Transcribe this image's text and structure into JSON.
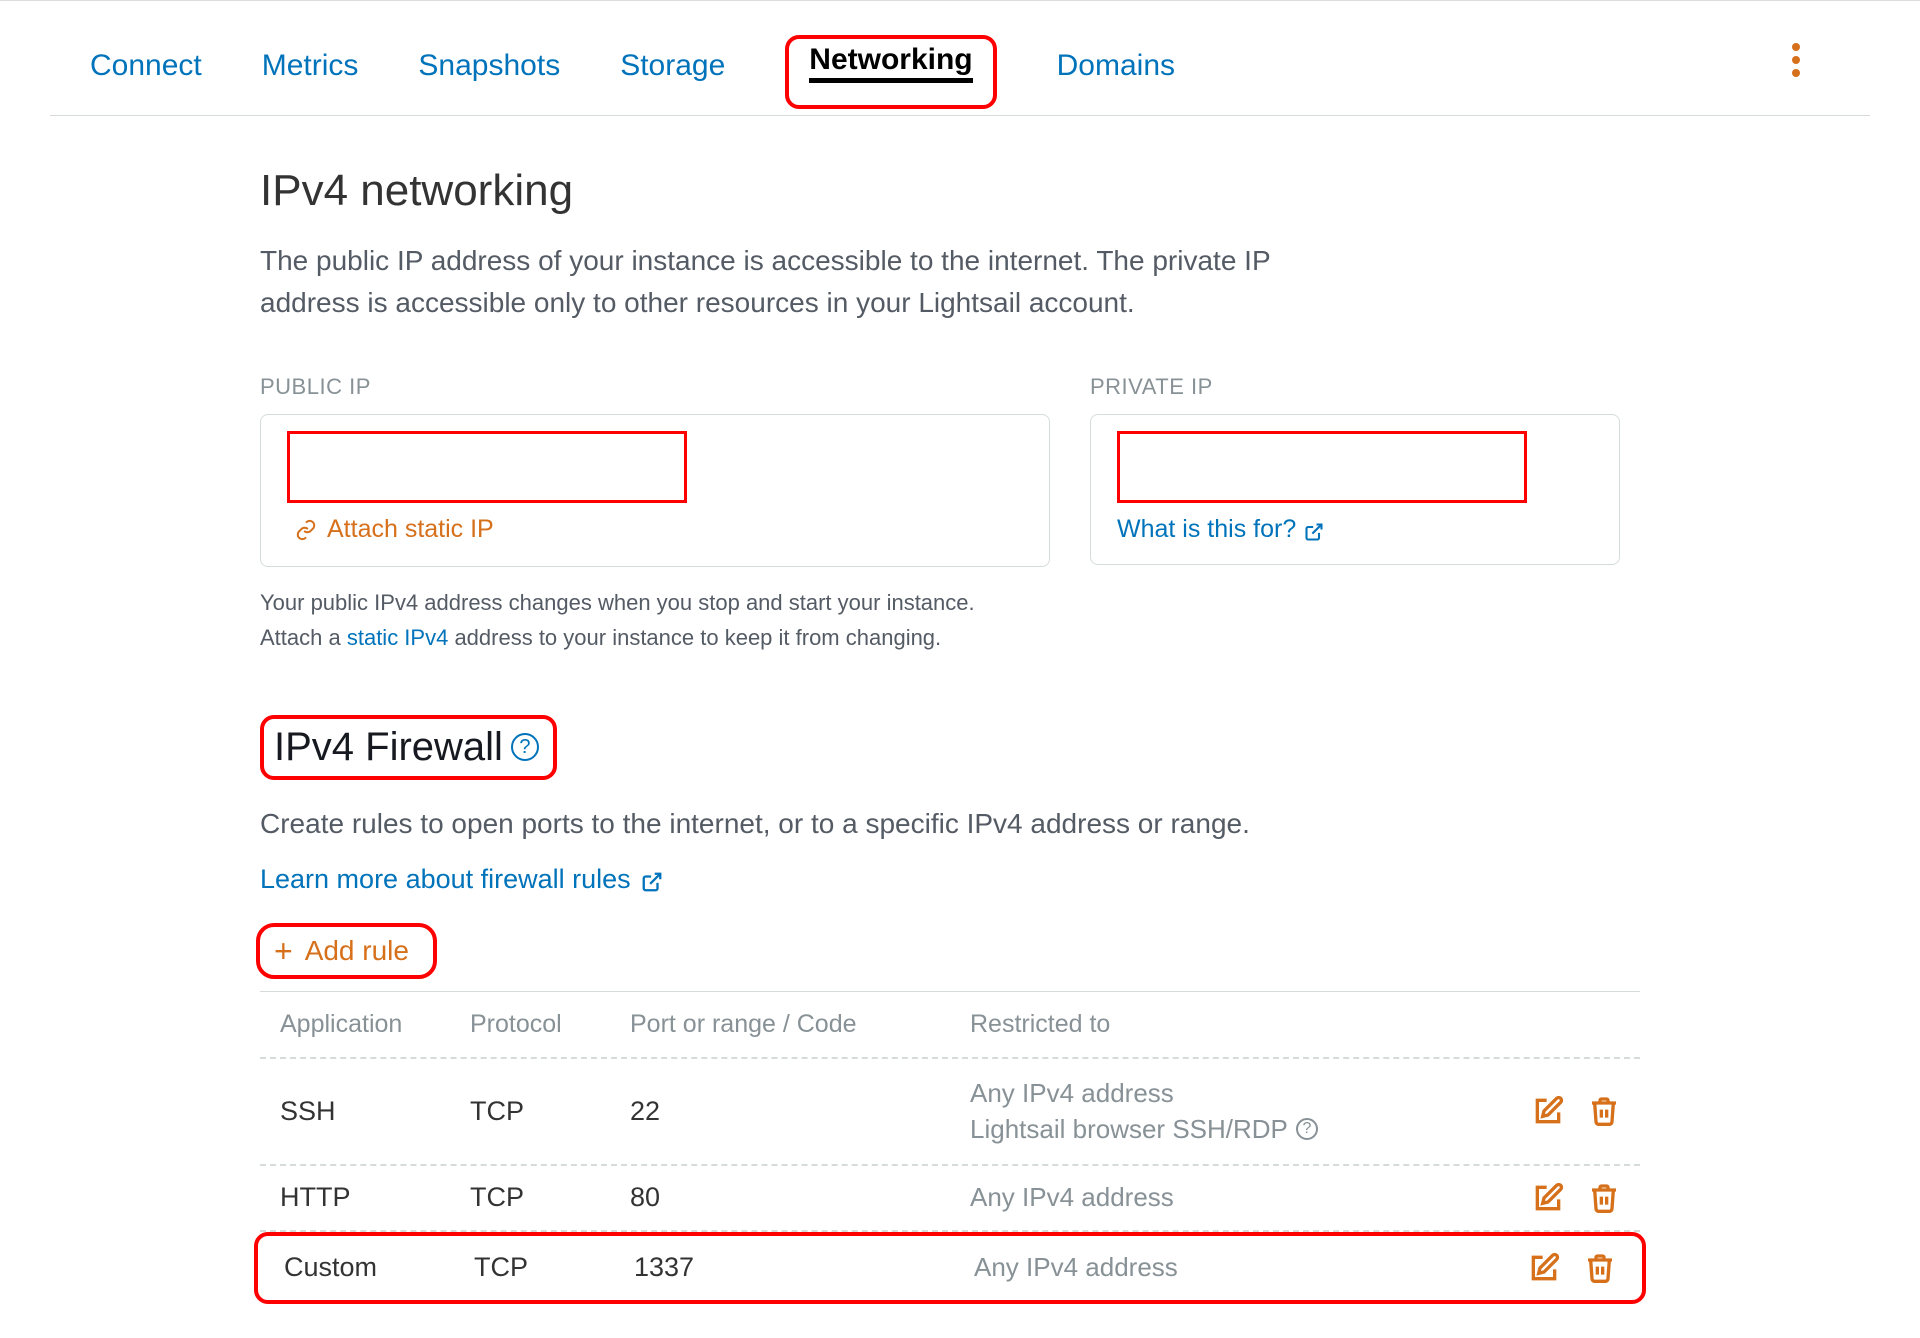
{
  "tabs": {
    "connect": "Connect",
    "metrics": "Metrics",
    "snapshots": "Snapshots",
    "storage": "Storage",
    "networking": "Networking",
    "domains": "Domains"
  },
  "heading": "IPv4 networking",
  "description": "The public IP address of your instance is accessible to the internet. The private IP address is accessible only to other resources in your Lightsail account.",
  "public_ip": {
    "label": "PUBLIC IP",
    "attach_link": "Attach static IP"
  },
  "private_ip": {
    "label": "PRIVATE IP",
    "what_link": "What is this for?"
  },
  "note": {
    "line1": "Your public IPv4 address changes when you stop and start your instance.",
    "line2_pre": "Attach a ",
    "line2_link": "static IPv4",
    "line2_post": " address to your instance to keep it from changing."
  },
  "firewall": {
    "heading": "IPv4 Firewall",
    "description": "Create rules to open ports to the internet, or to a specific IPv4 address or range.",
    "learn_link": "Learn more about firewall rules",
    "add_rule": "Add rule",
    "headers": {
      "application": "Application",
      "protocol": "Protocol",
      "port": "Port or range / Code",
      "restricted": "Restricted to"
    },
    "rules": [
      {
        "application": "SSH",
        "protocol": "TCP",
        "port": "22",
        "restricted_line1": "Any IPv4 address",
        "restricted_line2": "Lightsail browser SSH/RDP"
      },
      {
        "application": "HTTP",
        "protocol": "TCP",
        "port": "80",
        "restricted_line1": "Any IPv4 address",
        "restricted_line2": ""
      },
      {
        "application": "Custom",
        "protocol": "TCP",
        "port": "1337",
        "restricted_line1": "Any IPv4 address",
        "restricted_line2": ""
      }
    ]
  }
}
